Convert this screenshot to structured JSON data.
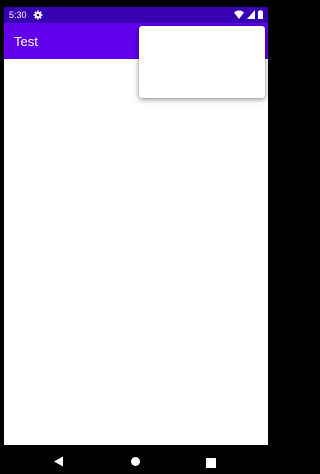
{
  "status_bar": {
    "time": "5:30",
    "icons": [
      "gear-icon",
      "wifi-icon",
      "signal-icon",
      "battery-icon"
    ]
  },
  "app_bar": {
    "title": "Test"
  },
  "popup_menu": {
    "items": []
  },
  "navigation_bar": {
    "icons": [
      "back-icon",
      "home-icon",
      "recents-icon"
    ]
  },
  "colors": {
    "status_bar": "#3700b3",
    "app_bar": "#6200ee",
    "background": "#ffffff",
    "frame": "#000000"
  }
}
